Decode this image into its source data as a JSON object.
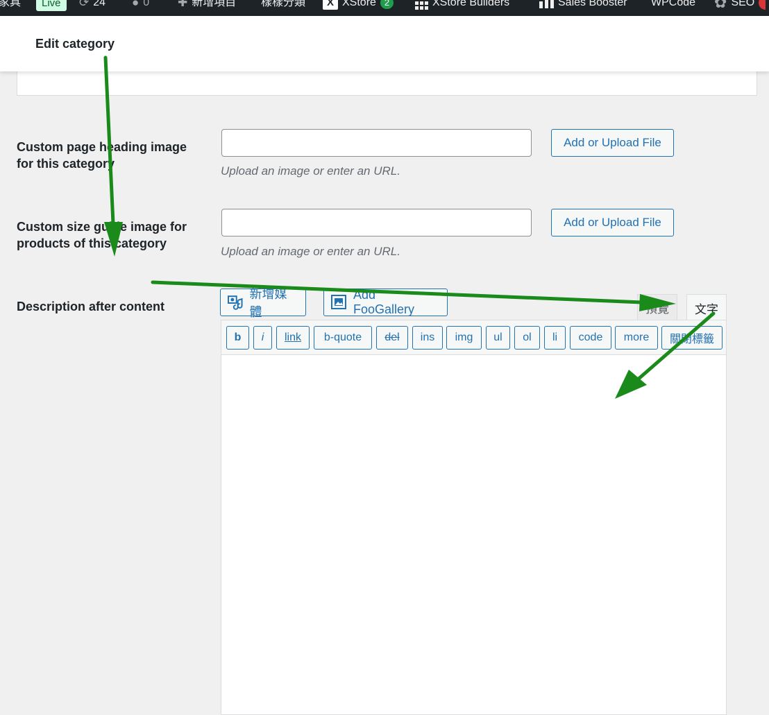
{
  "adminbar": {
    "site_name": "家具",
    "live_badge": "Live",
    "updates_count": "24",
    "comments_count": "0",
    "new_item": "新增項目",
    "item_categories": "樣樣分類",
    "xstore_label": "XStore",
    "xstore_logo": "X",
    "xstore_badge": "2",
    "xstore_builders": "XStore Builders",
    "sales_booster": "Sales Booster",
    "wpcode": "WPCode",
    "seo": "SEO"
  },
  "header": {
    "title": "Edit category"
  },
  "fields": {
    "heading_image": {
      "label": "Custom page heading image for this category",
      "value": "",
      "button": "Add or Upload File",
      "help": "Upload an image or enter an URL."
    },
    "size_guide": {
      "label": "Custom size guide image for products of this category",
      "value": "",
      "button": "Add or Upload File",
      "help": "Upload an image or enter an URL."
    },
    "description_after": {
      "label": "Description after content"
    }
  },
  "editor": {
    "add_media": "新增媒體",
    "add_foogallery": "Add FooGallery",
    "tab_preview": "預覽",
    "tab_text": "文字",
    "quicktags": [
      "b",
      "i",
      "link",
      "b-quote",
      "del",
      "ins",
      "img",
      "ul",
      "ol",
      "li",
      "code",
      "more",
      "關閉標籤"
    ],
    "content": ""
  },
  "icons": {
    "updates": "refresh-icon",
    "comments": "comment-icon",
    "new": "plus-icon",
    "media": "media-icon",
    "gallery": "gallery-icon"
  },
  "colors": {
    "adminbar_bg": "#1d2327",
    "accent": "#2271b1",
    "annotation_arrow": "#1a8a1a",
    "page_bg": "#f0f0f1"
  }
}
